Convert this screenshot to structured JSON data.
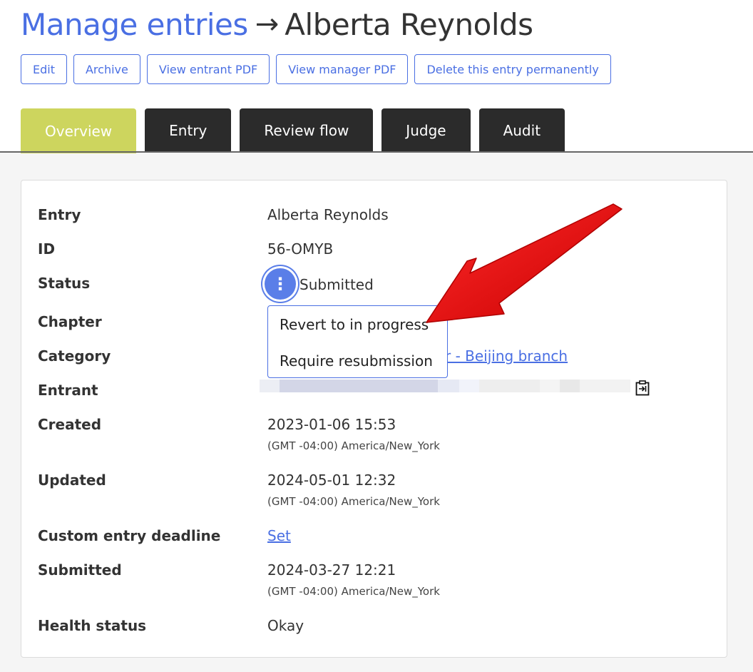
{
  "header": {
    "link_text": "Manage entries",
    "arrow": "→",
    "entrant_name": "Alberta Reynolds"
  },
  "actions": [
    {
      "label": "Edit"
    },
    {
      "label": "Archive"
    },
    {
      "label": "View entrant PDF"
    },
    {
      "label": "View manager PDF"
    },
    {
      "label": "Delete this entry permanently"
    }
  ],
  "tabs": [
    {
      "label": "Overview",
      "active": true
    },
    {
      "label": "Entry",
      "active": false
    },
    {
      "label": "Review flow",
      "active": false
    },
    {
      "label": "Judge",
      "active": false
    },
    {
      "label": "Audit",
      "active": false
    }
  ],
  "fields": {
    "entry": {
      "label": "Entry",
      "value": "Alberta Reynolds"
    },
    "id": {
      "label": "ID",
      "value": "56-OMYB"
    },
    "status": {
      "label": "Status",
      "value": "Submitted"
    },
    "chapter": {
      "label": "Chapter"
    },
    "category": {
      "label": "Category",
      "value_partial": "r - Beijing branch"
    },
    "entrant": {
      "label": "Entrant"
    },
    "created": {
      "label": "Created",
      "value": "2023-01-06 15:53",
      "tz": "(GMT -04:00) America/New_York"
    },
    "updated": {
      "label": "Updated",
      "value": "2024-05-01 12:32",
      "tz": "(GMT -04:00) America/New_York"
    },
    "deadline": {
      "label": "Custom entry deadline",
      "link": "Set"
    },
    "submitted": {
      "label": "Submitted",
      "value": "2024-03-27 12:21",
      "tz": "(GMT -04:00) America/New_York"
    },
    "health": {
      "label": "Health status",
      "value": "Okay"
    }
  },
  "status_menu": [
    {
      "label": "Revert to in progress"
    },
    {
      "label": "Require resubmission"
    }
  ],
  "icons": {
    "kebab": "more-vertical-icon",
    "copy": "copy-clipboard-icon",
    "callout": "red-arrow-annotation"
  },
  "colors": {
    "link_blue": "#4a6fe3",
    "tab_active": "#cdd55e",
    "tab_inactive": "#2b2b2b",
    "annotation_red": "#e40000"
  }
}
